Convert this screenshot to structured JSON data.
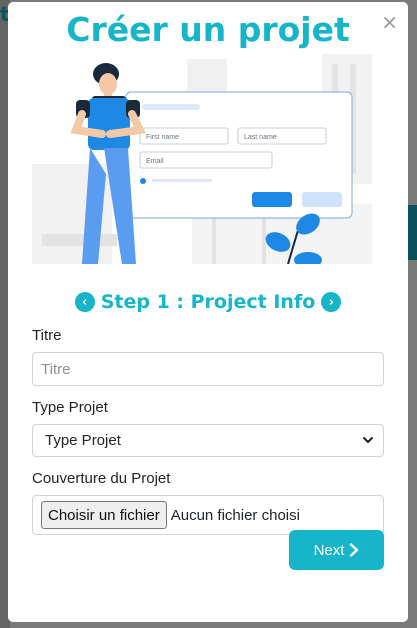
{
  "background": {
    "heading_glimpse": "t"
  },
  "modal": {
    "title": "Créer un projet",
    "close_glyph": "×",
    "illustration": {
      "first_name_placeholder": "First name",
      "last_name_placeholder": "Last name",
      "email_placeholder": "Email"
    },
    "step": {
      "prev_glyph": "‹",
      "title": "Step 1 : Project Info",
      "next_glyph": "›"
    },
    "form": {
      "titre_label": "Titre",
      "titre_placeholder": "Titre",
      "titre_value": "",
      "type_label": "Type Projet",
      "type_selected": "Type Projet",
      "cover_label": "Couverture du Projet",
      "file_button": "Choisir un fichier",
      "file_status": "Aucun fichier choisi"
    },
    "next_button": {
      "label": "Next",
      "icon": "chevron-right-icon"
    }
  },
  "colors": {
    "accent": "#17b5ca",
    "overlay": "rgba(0,0,0,0.5)"
  }
}
